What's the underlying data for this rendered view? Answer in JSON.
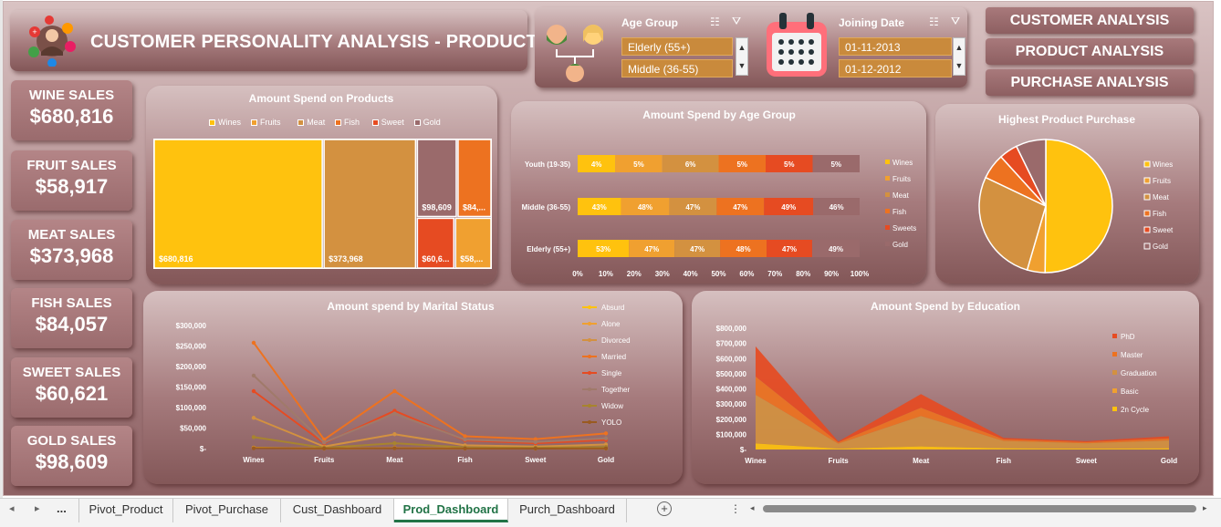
{
  "header": {
    "title": "CUSTOMER PERSONALITY ANALYSIS - PRODUCT"
  },
  "nav": {
    "buttons": [
      "CUSTOMER ANALYSIS",
      "PRODUCT ANALYSIS",
      "PURCHASE ANALYSIS"
    ]
  },
  "slicers": {
    "age": {
      "title": "Age Group",
      "items": [
        "Elderly (55+)",
        "Middle (36-55)"
      ]
    },
    "date": {
      "title": "Joining Date",
      "items": [
        "01-11-2013",
        "01-12-2012"
      ]
    }
  },
  "kpis": [
    {
      "label": "WINE SALES",
      "value": "$680,816"
    },
    {
      "label": "FRUIT SALES",
      "value": "$58,917"
    },
    {
      "label": "MEAT SALES",
      "value": "$373,968"
    },
    {
      "label": "FISH SALES",
      "value": "$84,057"
    },
    {
      "label": "SWEET SALES",
      "value": "$60,621"
    },
    {
      "label": "GOLD SALES",
      "value": "$98,609"
    }
  ],
  "colors": {
    "wines": "#ffc20e",
    "fruits": "#f0a030",
    "meat": "#d39140",
    "fish": "#ed7220",
    "sweet": "#e64b22",
    "gold": "#9a6a6b"
  },
  "chart_data": [
    {
      "type": "treemap",
      "title": "Amount Spend on Products",
      "legend": [
        "Wines",
        "Fruits",
        "Meat",
        "Fish",
        "Sweet",
        "Gold"
      ],
      "labels": [
        "$680,816",
        "$373,968",
        "$98,609",
        "$84,...",
        "$60,6...",
        "$58,..."
      ],
      "values": [
        680816,
        373968,
        98609,
        84057,
        60621,
        58917
      ]
    },
    {
      "type": "bar",
      "stacked": "100%",
      "title": "Amount Spend by Age Group",
      "categories": [
        "Youth (19-35)",
        "Middle (36-55)",
        "Elderly (55+)"
      ],
      "series": [
        {
          "name": "Wines",
          "values": [
            4,
            43,
            53
          ]
        },
        {
          "name": "Fruits",
          "values": [
            5,
            48,
            47
          ]
        },
        {
          "name": "Meat",
          "values": [
            6,
            47,
            47
          ]
        },
        {
          "name": "Fish",
          "values": [
            5,
            47,
            48
          ]
        },
        {
          "name": "Sweets",
          "values": [
            5,
            49,
            47
          ]
        },
        {
          "name": "Gold",
          "values": [
            5,
            46,
            49
          ]
        }
      ],
      "xticks": [
        "0%",
        "10%",
        "20%",
        "30%",
        "40%",
        "50%",
        "60%",
        "70%",
        "80%",
        "90%",
        "100%"
      ]
    },
    {
      "type": "pie",
      "title": "Highest Product Purchase",
      "legend": [
        "Wines",
        "Fruits",
        "Meat",
        "Fish",
        "Sweet",
        "Gold"
      ],
      "values": [
        680816,
        58917,
        373968,
        84057,
        60621,
        98609
      ]
    },
    {
      "type": "line",
      "title": "Amount  spend by Marital Status",
      "categories": [
        "Wines",
        "Fruits",
        "Meat",
        "Fish",
        "Sweet",
        "Gold"
      ],
      "yticks": [
        "$300,000",
        "$250,000",
        "$200,000",
        "$150,000",
        "$100,000",
        "$50,000",
        "$-"
      ],
      "ylim": [
        0,
        300000
      ],
      "series": [
        {
          "name": "Absurd",
          "values": [
            2000,
            300,
            1500,
            400,
            300,
            500
          ]
        },
        {
          "name": "Alone",
          "values": [
            1500,
            200,
            1200,
            300,
            200,
            400
          ]
        },
        {
          "name": "Divorced",
          "values": [
            75000,
            5000,
            35000,
            8000,
            5000,
            10000
          ]
        },
        {
          "name": "Married",
          "values": [
            258000,
            22000,
            140000,
            30000,
            23000,
            37000
          ]
        },
        {
          "name": "Single",
          "values": [
            140000,
            13000,
            92000,
            20000,
            13000,
            21000
          ]
        },
        {
          "name": "Together",
          "values": [
            178000,
            15000,
            85000,
            22000,
            16000,
            25000
          ]
        },
        {
          "name": "Widow",
          "values": [
            28000,
            2000,
            13000,
            3000,
            2000,
            4000
          ]
        },
        {
          "name": "YOLO",
          "values": [
            1000,
            200,
            900,
            200,
            100,
            300
          ]
        }
      ]
    },
    {
      "type": "area",
      "stacked": true,
      "title": "Amount Spend by Education",
      "categories": [
        "Wines",
        "Fruits",
        "Meat",
        "Fish",
        "Sweet",
        "Gold"
      ],
      "yticks": [
        "$800,000",
        "$700,000",
        "$600,000",
        "$500,000",
        "$400,000",
        "$300,000",
        "$200,000",
        "$100,000",
        "$-"
      ],
      "ylim": [
        0,
        800000
      ],
      "series": [
        {
          "name": "2n Cycle",
          "values": [
            40000,
            6000,
            20000,
            8000,
            6000,
            8000
          ]
        },
        {
          "name": "Basic",
          "values": [
            300,
            500,
            300,
            600,
            400,
            1200
          ]
        },
        {
          "name": "Graduation",
          "values": [
            320000,
            32000,
            200000,
            48000,
            34000,
            50000
          ]
        },
        {
          "name": "Master",
          "values": [
            120000,
            8000,
            55000,
            10000,
            8000,
            14000
          ]
        },
        {
          "name": "PhD",
          "values": [
            200000,
            6000,
            90000,
            10000,
            7000,
            14000
          ]
        }
      ]
    }
  ],
  "tabs": {
    "items": [
      "Pivot_Product",
      "Pivot_Purchase",
      "Cust_Dashboard",
      "Prod_Dashboard",
      "Purch_Dashboard"
    ],
    "ellipsis": "..."
  }
}
